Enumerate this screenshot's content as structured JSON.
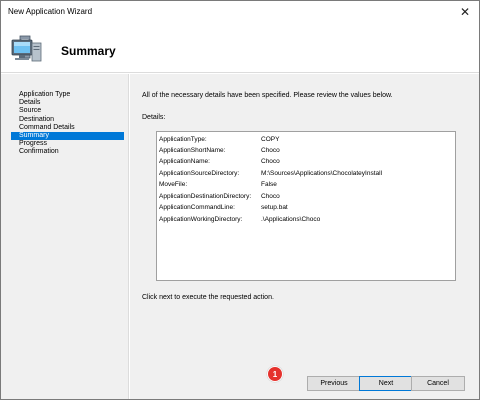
{
  "window": {
    "title": "New Application Wizard",
    "close_glyph": "✕"
  },
  "header": {
    "title": "Summary",
    "icon": "computer-icon"
  },
  "sidebar": {
    "items": [
      {
        "label": "Application Type",
        "active": false
      },
      {
        "label": "Details",
        "active": false
      },
      {
        "label": "Source",
        "active": false
      },
      {
        "label": "Destination",
        "active": false
      },
      {
        "label": "Command Details",
        "active": false
      },
      {
        "label": "Summary",
        "active": true
      },
      {
        "label": "Progress",
        "active": false
      },
      {
        "label": "Confirmation",
        "active": false
      }
    ]
  },
  "main": {
    "intro": "All of the necessary details have been specified.  Please review the values below.",
    "details_label": "Details:",
    "details": [
      {
        "key": "ApplicationType:",
        "value": "COPY"
      },
      {
        "key": "ApplicationShortName:",
        "value": "Choco"
      },
      {
        "key": "ApplicationName:",
        "value": "Choco"
      },
      {
        "key": "ApplicationSourceDirectory:",
        "value": "M:\\Sources\\Applications\\ChocolateyInstall"
      },
      {
        "key": "MoveFile:",
        "value": "False"
      },
      {
        "key": "ApplicationDestinationDirectory:",
        "value": "Choco"
      },
      {
        "key": "ApplicationCommandLine:",
        "value": "setup.bat"
      },
      {
        "key": "ApplicationWorkingDirectory:",
        "value": ".\\Applications\\Choco"
      }
    ],
    "footer_note": "Click next to execute the requested action."
  },
  "buttons": {
    "previous": "Previous",
    "next": "Next",
    "cancel": "Cancel"
  },
  "annotation": {
    "badge": "1"
  },
  "colors": {
    "selection": "#0078d7",
    "badge": "#e5322d",
    "panel": "#f0f0f0"
  }
}
